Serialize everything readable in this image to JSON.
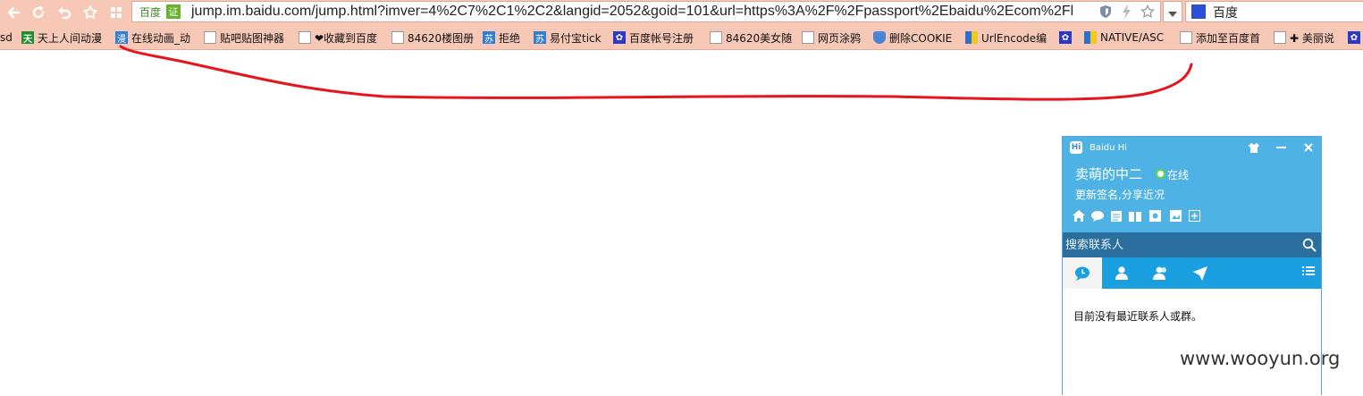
{
  "browser": {
    "url_brand": "百度",
    "url_ev_badge": "证",
    "url": "jump.im.baidu.com/jump.html?imver=4%2C7%2C1%2C2&langid=2052&goid=101&url=https%3A%2F%2Fpassport%2Ebaidu%2Ecom%2Fl",
    "search_engine": "百度",
    "icons": [
      "back-icon",
      "refresh-icon",
      "undo-icon",
      "star-icon",
      "apps-icon",
      "shield-icon",
      "bolt-icon",
      "bookmark-star-icon",
      "chevron-down-icon"
    ]
  },
  "bookmarks": [
    {
      "label": "sd",
      "icon": "none"
    },
    {
      "label": "天上人间动漫",
      "icon": "tian-icon"
    },
    {
      "label": "在线动画_动",
      "icon": "man-icon"
    },
    {
      "label": "贴吧贴图神器",
      "icon": "page-icon"
    },
    {
      "label": "❤收藏到百度",
      "icon": "page-icon"
    },
    {
      "label": "84620楼图册",
      "icon": "page-icon"
    },
    {
      "label": "拒绝",
      "icon": "su-icon"
    },
    {
      "label": "易付宝tick",
      "icon": "su-icon"
    },
    {
      "label": "百度帐号注册",
      "icon": "paw-icon"
    },
    {
      "label": "84620美女随",
      "icon": "page-icon"
    },
    {
      "label": "网页涂鸦",
      "icon": "page-icon"
    },
    {
      "label": "删除COOKIE",
      "icon": "shield-icon"
    },
    {
      "label": "UrlEncode编",
      "icon": "multi-icon"
    },
    {
      "label": "",
      "icon": "paw-icon"
    },
    {
      "label": "NATIVE/ASC",
      "icon": "multi-icon"
    },
    {
      "label": "添加至百度首",
      "icon": "page-icon"
    },
    {
      "label": "✚ 美丽说",
      "icon": "page-icon"
    },
    {
      "label": "",
      "icon": "paw-icon"
    }
  ],
  "baidu_hi": {
    "title": "Baidu Hi",
    "logo": "Hi",
    "username": "卖萌的中二",
    "status": "在线",
    "signature": "更新签名,分享近况",
    "search_placeholder": "搜索联系人",
    "empty_message": "目前没有最近联系人或群。",
    "tool_icons": [
      "home-icon",
      "chat-icon",
      "notes-icon",
      "book-icon",
      "post-icon",
      "album-icon",
      "add-icon"
    ],
    "tabs": [
      "recent-tab",
      "contacts-tab",
      "groups-tab",
      "send-tab"
    ],
    "colors": {
      "header": "#4fb2e4",
      "search": "#2a6f9e",
      "tabs": "#1a9fe0",
      "status": "#58d94a"
    }
  },
  "annotation": {
    "color": "#e8141b"
  },
  "watermark": "www.wooyun.org"
}
